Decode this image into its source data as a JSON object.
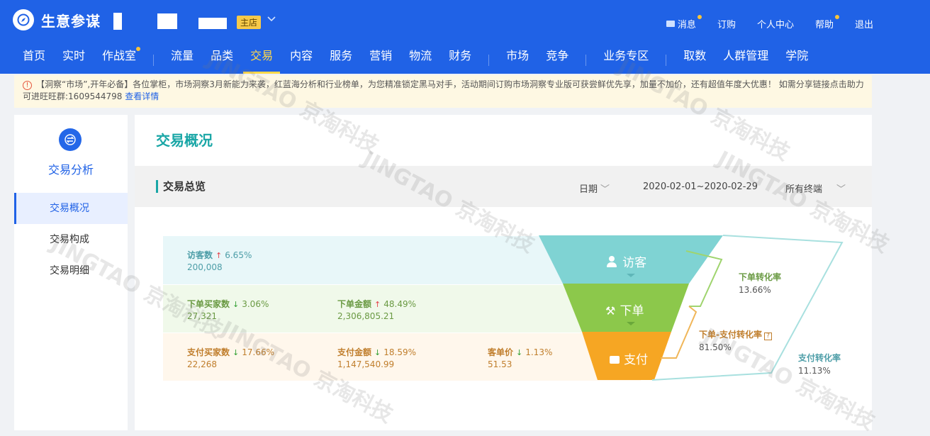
{
  "app": {
    "name": "生意参谋",
    "shop_badge": "主店"
  },
  "top_links": [
    {
      "label": "消息",
      "dot": true
    },
    {
      "label": "订购",
      "dot": false
    },
    {
      "label": "个人中心",
      "dot": false
    },
    {
      "label": "帮助",
      "dot": true
    },
    {
      "label": "退出",
      "dot": false
    }
  ],
  "nav": {
    "items": [
      "首页",
      "实时",
      "作战室",
      "流量",
      "品类",
      "交易",
      "内容",
      "服务",
      "营销",
      "物流",
      "财务",
      "市场",
      "竞争",
      "业务专区",
      "取数",
      "人群管理",
      "学院"
    ],
    "active": "交易"
  },
  "notice": {
    "text": "【洞察“市场”,开年必备】各位掌柜，市场洞察3月新能力来袭，红蓝海分析和行业榜单，为您精准锁定黑马对手，活动期间订购市场洞察专业版可获尝鲜优先享，加量不加价，还有超值年度大优惠！ 如需分享链接点击助力可进旺旺群:1609544798",
    "link": "查看详情"
  },
  "sidebar": {
    "title": "交易分析",
    "items": [
      "交易概况",
      "交易构成",
      "交易明细"
    ],
    "active": "交易概况"
  },
  "main": {
    "page_title": "交易概况",
    "section_title": "交易总览",
    "date_label": "日期",
    "date_range": "2020-02-01~2020-02-29",
    "terminal": "所有终端"
  },
  "metrics": {
    "visitors": {
      "label": "访客数",
      "trend": "up",
      "pct": "6.65%",
      "value": "200,008"
    },
    "order_buyers": {
      "label": "下单买家数",
      "trend": "down",
      "pct": "3.06%",
      "value": "27,321"
    },
    "order_amount": {
      "label": "下单金额",
      "trend": "up",
      "pct": "48.49%",
      "value": "2,306,805.21"
    },
    "pay_buyers": {
      "label": "支付买家数",
      "trend": "down",
      "pct": "17.66%",
      "value": "22,268"
    },
    "pay_amount": {
      "label": "支付金额",
      "trend": "down",
      "pct": "18.59%",
      "value": "1,147,540.99"
    },
    "unit_price": {
      "label": "客单价",
      "trend": "down",
      "pct": "1.13%",
      "value": "51.53"
    }
  },
  "funnel": {
    "stages": [
      "访客",
      "下单",
      "支付"
    ],
    "colors": {
      "visit": "#7fd3d3",
      "order": "#8cc84b",
      "pay": "#f6a623"
    }
  },
  "conversions": {
    "order_rate": {
      "label": "下单转化率",
      "value": "13.66%"
    },
    "order_pay_rate": {
      "label": "下单-支付转化率",
      "value": "81.50%"
    },
    "pay_rate": {
      "label": "支付转化率",
      "value": "11.13%"
    }
  },
  "watermark": "JINGTAO 京淘科技"
}
